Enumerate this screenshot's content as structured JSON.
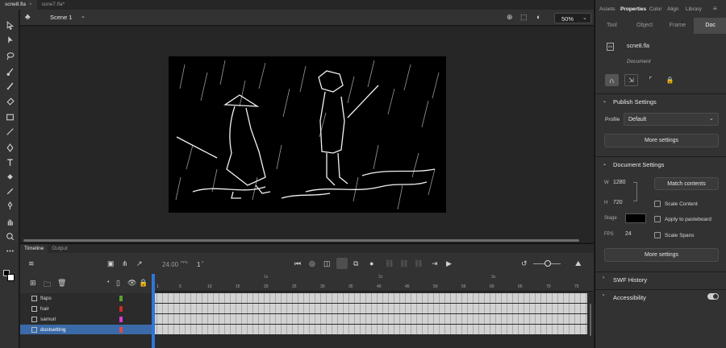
{
  "doc_tabs": [
    {
      "label": "scne8.fla",
      "close": "×"
    },
    {
      "label": "scne7.fla*",
      "close": ""
    }
  ],
  "scene": {
    "label": "Scene 1",
    "zoom": "50%"
  },
  "timeline_tabs": [
    "Timeline",
    "Output"
  ],
  "timeline": {
    "fps": "24.00",
    "fps_unit": "FPS",
    "frame": "1",
    "frame_unit": "F",
    "seconds": [
      "1s",
      "2s",
      "3s"
    ],
    "frame_numbers": [
      "1",
      "5",
      "10",
      "15",
      "20",
      "25",
      "30",
      "35",
      "40",
      "45",
      "50",
      "55",
      "60",
      "65",
      "70",
      "75",
      "80",
      "85",
      "90"
    ],
    "layers": [
      {
        "name": "flaps",
        "color": "#5aa02c"
      },
      {
        "name": "hair",
        "color": "#cf2a2a"
      },
      {
        "name": "samuri",
        "color": "#d23fd2"
      },
      {
        "name": "dustsetting",
        "color": "#e04a4a"
      }
    ]
  },
  "panel": {
    "tabs": [
      "Assets",
      "Properties",
      "Color",
      "Align",
      "Library"
    ],
    "subtabs": [
      "Tool",
      "Object",
      "Frame",
      "Doc"
    ],
    "doc_name": "scne8.fla",
    "doc_type": "Document",
    "publish": {
      "title": "Publish Settings",
      "profile_label": "Profile",
      "profile_value": "Default",
      "more": "More settings"
    },
    "document": {
      "title": "Document Settings",
      "w_label": "W",
      "w_value": "1280",
      "h_label": "H",
      "h_value": "720",
      "match": "Match contents",
      "stage_label": "Stage",
      "stage_color": "#000000",
      "fps_label": "FPS",
      "fps_value": "24",
      "scale_content": "Scale Content",
      "apply_pasteboard": "Apply to pasteboard",
      "scale_spans": "Scale Spans",
      "more": "More settings"
    },
    "swf_history": "SWF History",
    "accessibility": "Accessibility"
  },
  "colors": {
    "accent": "#2f76d6",
    "selection": "#3b6aa8",
    "panel": "#323232"
  }
}
